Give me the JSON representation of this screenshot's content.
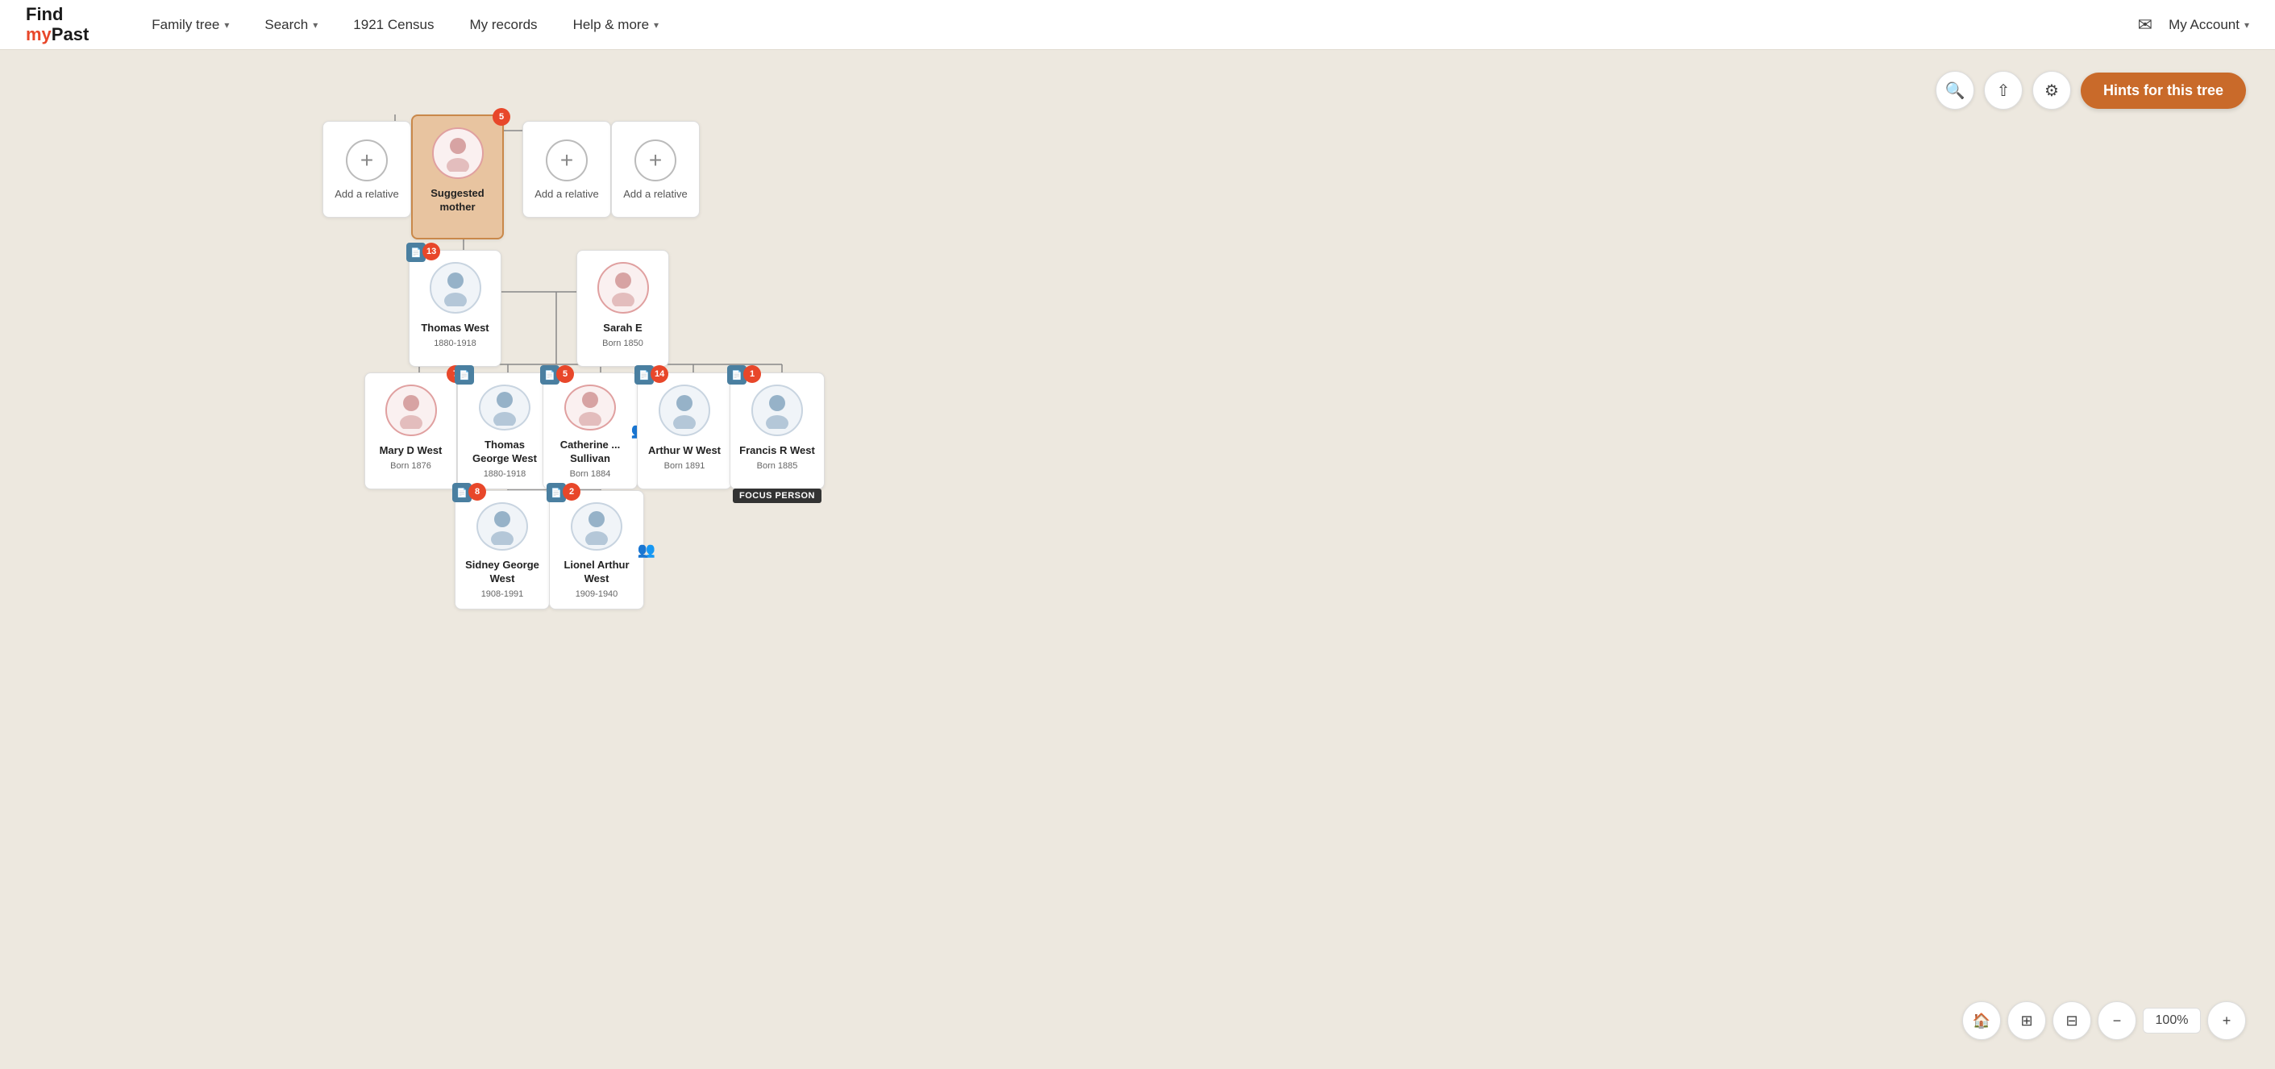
{
  "logo": {
    "line1": "Find",
    "line2": "my",
    "line2_accent": "Past"
  },
  "nav": {
    "items": [
      {
        "label": "Family tree",
        "has_arrow": true
      },
      {
        "label": "Search",
        "has_arrow": true
      },
      {
        "label": "1921 Census",
        "has_arrow": false
      },
      {
        "label": "My records",
        "has_arrow": false
      },
      {
        "label": "Help & more",
        "has_arrow": true
      }
    ],
    "account_label": "My Account",
    "hints_label": "Hints for this tree"
  },
  "zoom": {
    "level": "100%",
    "minus_label": "−",
    "plus_label": "+"
  },
  "tree": {
    "persons": [
      {
        "id": "suggested-mother",
        "name": "Suggested mother",
        "dates": "",
        "type": "suggested",
        "badge": "5",
        "badge_type": "orange"
      },
      {
        "id": "add-father-gp",
        "name": "Add a relative",
        "type": "add"
      },
      {
        "id": "add-mother-gp",
        "name": "Add a relative",
        "type": "add"
      },
      {
        "id": "add-paternal-gp",
        "name": "Add a relative",
        "type": "add"
      },
      {
        "id": "thomas-west",
        "name": "Thomas West",
        "dates": "1880-1918",
        "type": "male",
        "badge": "13",
        "badge_type": "orange",
        "doc_badge": true
      },
      {
        "id": "sarah-e",
        "name": "Sarah E",
        "dates": "Born 1850",
        "type": "female"
      },
      {
        "id": "mary-d-west",
        "name": "Mary D West",
        "dates": "Born 1876",
        "type": "female",
        "badge": "7",
        "badge_type": "orange"
      },
      {
        "id": "thomas-george-west",
        "name": "Thomas George West",
        "dates": "1880-1918",
        "type": "male",
        "doc_badge": true
      },
      {
        "id": "catherine-sullivan",
        "name": "Catherine ... Sullivan",
        "dates": "Born 1884",
        "type": "female",
        "badge": "5",
        "badge_type": "orange",
        "doc_badge": true
      },
      {
        "id": "arthur-w-west",
        "name": "Arthur W West",
        "dates": "Born 1891",
        "type": "male",
        "badge": "14",
        "badge_type": "orange",
        "doc_badge": true
      },
      {
        "id": "francis-r-west",
        "name": "Francis R West",
        "dates": "Born 1885",
        "type": "male",
        "badge": "1",
        "badge_type": "orange",
        "doc_badge": true,
        "focus": true
      },
      {
        "id": "sidney-george-west",
        "name": "Sidney George West",
        "dates": "1908-1991",
        "type": "male",
        "badge": "8",
        "badge_type": "orange",
        "doc_badge": true
      },
      {
        "id": "lionel-arthur-west",
        "name": "Lionel Arthur West",
        "dates": "1909-1940",
        "type": "male",
        "badge": "2",
        "badge_type": "orange",
        "doc_badge": true
      }
    ],
    "focus_label": "FOCUS PERSON"
  }
}
